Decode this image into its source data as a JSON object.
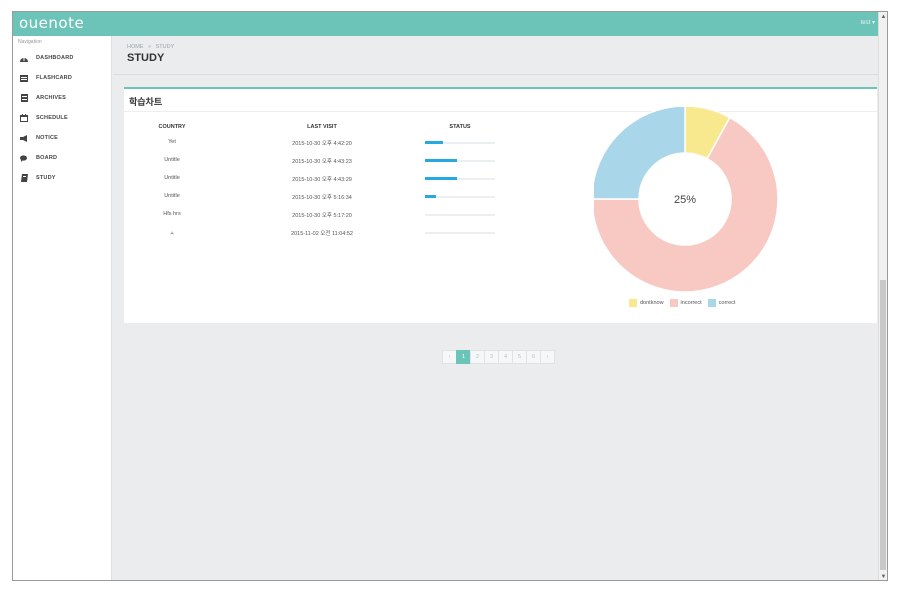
{
  "app": {
    "logo": "ouenote",
    "user_menu": "test ▾"
  },
  "sidebar": {
    "heading": "Navigation",
    "items": [
      {
        "label": "DASHBOARD",
        "icon": "dashboard-icon"
      },
      {
        "label": "FLASHCARD",
        "icon": "flashcard-icon"
      },
      {
        "label": "ARCHIVES",
        "icon": "archive-icon"
      },
      {
        "label": "SCHEDULE",
        "icon": "calendar-icon"
      },
      {
        "label": "NOTICE",
        "icon": "megaphone-icon"
      },
      {
        "label": "BOARD",
        "icon": "comments-icon"
      },
      {
        "label": "STUDY",
        "icon": "book-icon"
      }
    ]
  },
  "breadcrumb": {
    "home": "HOME",
    "separator": "»",
    "current": "STUDY"
  },
  "page": {
    "title": "STUDY"
  },
  "card": {
    "title": "학습차트",
    "table": {
      "headers": [
        "COUNTRY",
        "LAST VISIT",
        "STATUS"
      ],
      "rows": [
        {
          "country": "Yet",
          "last_visit": "2015-10-30 오후 4:42:20",
          "status": 0.26
        },
        {
          "country": "Untitle",
          "last_visit": "2015-10-30 오후 4:43:23",
          "status": 0.46
        },
        {
          "country": "Untitle",
          "last_visit": "2015-10-30 오후 4:43:29",
          "status": 0.46
        },
        {
          "country": "Untitle",
          "last_visit": "2015-10-30 오후 5:16:34",
          "status": 0.16
        },
        {
          "country": "Hfs hrs",
          "last_visit": "2015-10-30 오후 5:17:20",
          "status": 0
        },
        {
          "country": "ㅅ",
          "last_visit": "2015-11-02 오전 11:04:52",
          "status": 0
        }
      ]
    }
  },
  "chart_data": {
    "type": "pie",
    "style": "donut",
    "center_label": "25%",
    "categories": [
      "dontknow",
      "incorrect",
      "correct"
    ],
    "values": [
      8,
      67,
      25
    ],
    "colors": [
      "#f9e98e",
      "#f8c9c2",
      "#a9d6e8"
    ],
    "legend_position": "bottom"
  },
  "pagination": {
    "prev": "‹",
    "pages": [
      "1",
      "2",
      "3",
      "4",
      "5",
      "6"
    ],
    "next": "›",
    "active_page": "1"
  },
  "colors": {
    "accent": "#6cc4b8",
    "progress": "#27a8e0",
    "background": "#ebecee"
  }
}
